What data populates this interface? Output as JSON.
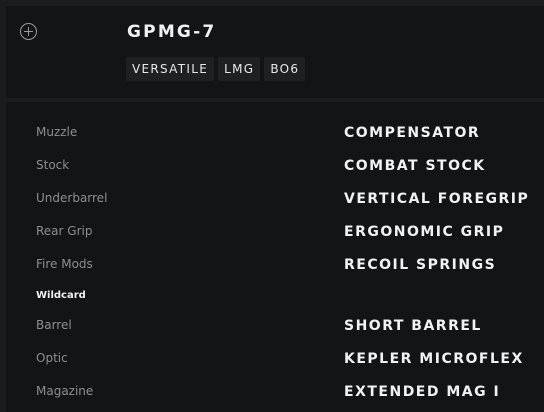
{
  "weapon": {
    "name": "GPMG-7",
    "tags": [
      "VERSATILE",
      "LMG",
      "BO6"
    ]
  },
  "loadout": {
    "muzzle_label": "Muzzle",
    "muzzle_value": "COMPENSATOR",
    "stock_label": "Stock",
    "stock_value": "COMBAT STOCK",
    "underbarrel_label": "Underbarrel",
    "underbarrel_value": "VERTICAL FOREGRIP",
    "rear_grip_label": "Rear Grip",
    "rear_grip_value": "ERGONOMIC GRIP",
    "fire_mods_label": "Fire Mods",
    "fire_mods_value": "RECOIL SPRINGS",
    "wildcard_label": "Wildcard",
    "barrel_label": "Barrel",
    "barrel_value": "SHORT BARREL",
    "optic_label": "Optic",
    "optic_value": "KEPLER MICROFLEX",
    "magazine_label": "Magazine",
    "magazine_value": "EXTENDED MAG I"
  },
  "icons": {
    "add": "plus-circle-icon"
  }
}
